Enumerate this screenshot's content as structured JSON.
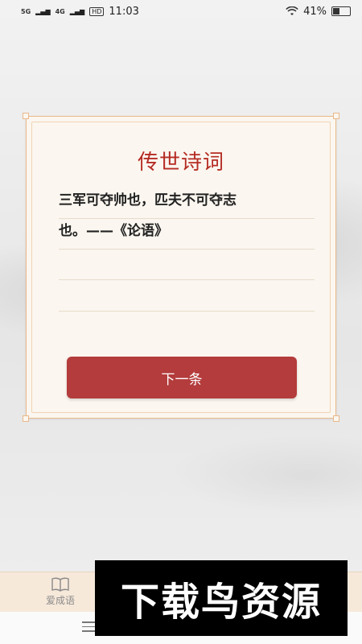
{
  "status_bar": {
    "signal1": "5G",
    "signal2": "4G",
    "hd": "HD",
    "time": "11:03",
    "battery_percent": "41%",
    "battery_level": 0.41
  },
  "card": {
    "title": "传世诗词",
    "lines": [
      "三军可夺帅也，匹夫不可夺志",
      "也。——《论语》",
      "",
      ""
    ],
    "next_button": "下一条"
  },
  "tabbar": {
    "items": [
      {
        "label": "爱成语",
        "icon": "book-icon"
      }
    ]
  },
  "watermark": {
    "text": "下载鸟资源"
  },
  "colors": {
    "accent": "#b43c3c",
    "title": "#b52c24",
    "card_border": "#e9b88a",
    "tabbar_bg": "#f7e9da"
  }
}
